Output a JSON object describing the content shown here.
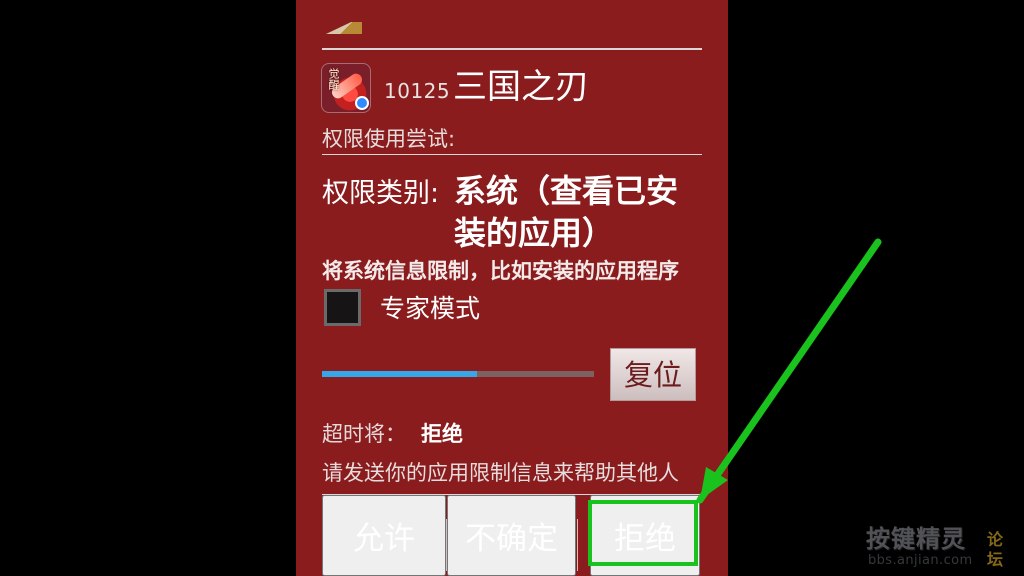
{
  "colors": {
    "panel": "#8a1c1e",
    "accent": "#19c21c",
    "progress": "#35a7e8"
  },
  "app": {
    "icon": "game-app-icon",
    "icon_mark": "觉醒",
    "id": "10125",
    "name": "三国之刃"
  },
  "permission": {
    "trial_label": "权限使用尝试:",
    "category_label": "权限类别:",
    "category_value": "系统（查看已安装的应用）",
    "description": "将系统信息限制，比如安装的应用程序",
    "expert_mode_label": "专家模式",
    "expert_mode_checked": false,
    "progress_percent": 57,
    "reset_label": "复位",
    "timeout_label": "超时将：",
    "timeout_value": "拒绝",
    "help_text": "请发送你的应用限制信息来帮助其他人"
  },
  "actions": {
    "allow_label": "允许",
    "unsure_label": "不确定",
    "deny_label": "拒绝"
  },
  "watermark": {
    "main": "按键精灵",
    "tag": "论坛",
    "url": "bbs.anjian.com"
  }
}
